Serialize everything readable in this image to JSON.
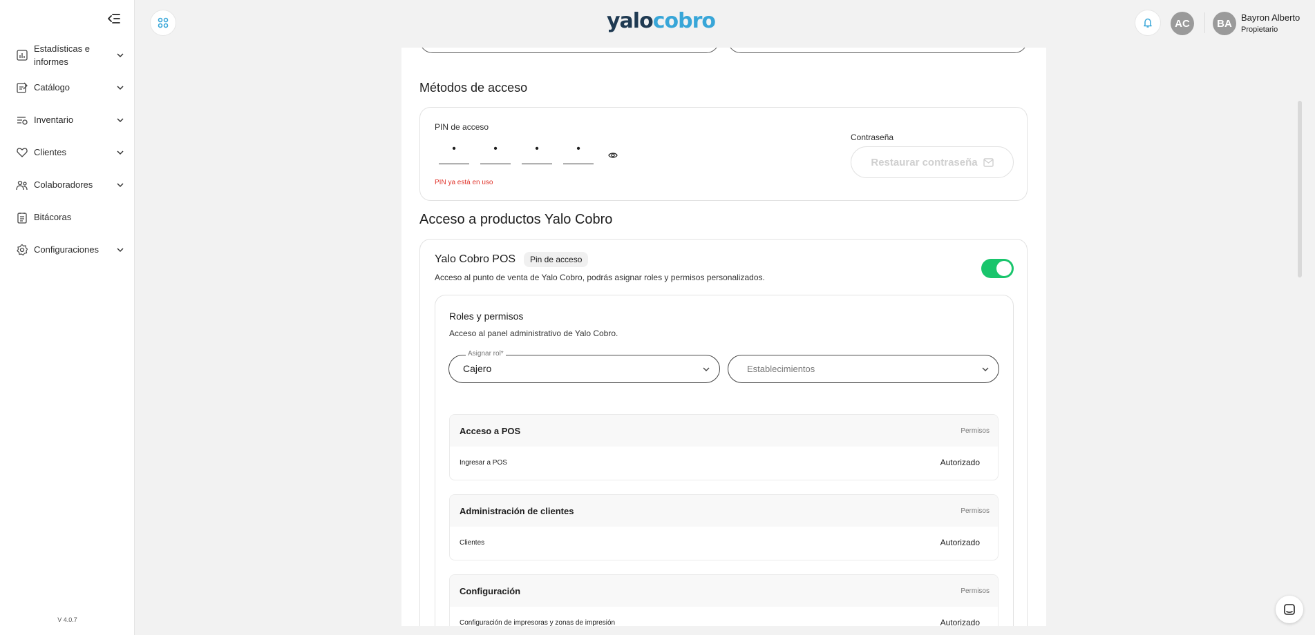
{
  "brand": {
    "logo_left": "yalo",
    "logo_right": "cobro"
  },
  "sidebar": {
    "items": [
      {
        "label": "Estadísticas e informes",
        "icon": "chart-icon"
      },
      {
        "label": "Catálogo",
        "icon": "catalog-icon"
      },
      {
        "label": "Inventario",
        "icon": "inventory-icon"
      },
      {
        "label": "Clientes",
        "icon": "clients-icon"
      },
      {
        "label": "Colaboradores",
        "icon": "collaborators-icon"
      },
      {
        "label": "Bitácoras",
        "icon": "logbook-icon"
      },
      {
        "label": "Configuraciones",
        "icon": "settings-icon"
      }
    ],
    "version": "V 4.0.7"
  },
  "header": {
    "avatar_ac": "AC",
    "avatar_ba": "BA",
    "user_name": "Bayron Alberto",
    "user_role": "Propietario"
  },
  "access_methods": {
    "title": "Métodos de acceso",
    "pin_label": "PIN de acceso",
    "pin_digits": [
      "•",
      "•",
      "•",
      "•"
    ],
    "pin_error": "PIN ya está en uso",
    "password_label": "Contraseña",
    "password_button": "Restaurar contraseña"
  },
  "products": {
    "title": "Acceso a productos Yalo Cobro",
    "pos_title": "Yalo Cobro POS",
    "pos_badge": "Pin de acceso",
    "pos_desc": "Acceso al punto de venta de Yalo Cobro, podrás asignar roles y permisos personalizados.",
    "pos_enabled": true
  },
  "roles": {
    "title": "Roles y permisos",
    "desc": "Acceso al panel administrativo de Yalo Cobro.",
    "role_label": "Asignar rol*",
    "role_value": "Cajero",
    "establishments_placeholder": "Establecimientos",
    "blocks": [
      {
        "title": "Acceso a POS",
        "perm_label": "Permisos",
        "row_name": "Ingresar a POS",
        "row_status": "Autorizado"
      },
      {
        "title": "Administración de clientes",
        "perm_label": "Permisos",
        "row_name": "Clientes",
        "row_status": "Autorizado"
      },
      {
        "title": "Configuración",
        "perm_label": "Permisos",
        "row_name": "Configuración de impresoras y zonas de impresión",
        "row_status": "Autorizado"
      }
    ]
  },
  "colors": {
    "accent": "#38a6d8",
    "toggle_on": "#19c56c",
    "error": "#e0342b",
    "brand_dark": "#1f3a52"
  }
}
